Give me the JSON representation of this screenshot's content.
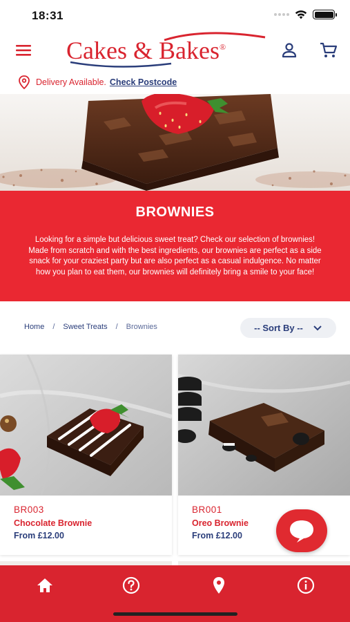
{
  "status_bar": {
    "time": "18:31"
  },
  "header": {
    "logo_text": "Cakes & Bakes",
    "logo_registered": "®"
  },
  "delivery": {
    "text": "Delivery Available.",
    "link": "Check Postcode"
  },
  "banner": {
    "title": "BROWNIES",
    "description": "Looking for a simple but delicious sweet treat? Check our selection of brownies! Made from scratch and with the best ingredients, our brownies are perfect as a side snack for your craziest party but are also perfect as a casual indulgence. No matter how you plan to eat them, our brownies will definitely bring a smile to your face!"
  },
  "breadcrumb": {
    "items": [
      "Home",
      "Sweet Treats",
      "Brownies"
    ],
    "separator": "/"
  },
  "sort": {
    "label": "-- Sort By --"
  },
  "products": [
    {
      "code": "BR003",
      "name": "Chocolate Brownie",
      "price": "From £12.00"
    },
    {
      "code": "BR001",
      "name": "Oreo Brownie",
      "price": "From £12.00"
    }
  ],
  "icons": {
    "menu": "menu-icon",
    "user": "user-icon",
    "cart": "cart-icon",
    "location": "location-pin-icon",
    "chevron": "chevron-down-icon",
    "chat": "chat-icon",
    "tabs": [
      "home-icon",
      "help-icon",
      "location-icon",
      "info-icon"
    ]
  },
  "colors": {
    "brand_red": "#ea2832",
    "navy": "#2a3d7a",
    "tab_bar": "#d9242f"
  }
}
